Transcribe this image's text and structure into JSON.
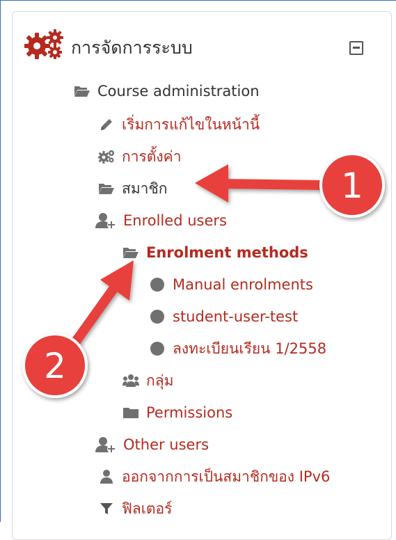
{
  "block": {
    "title": "การจัดการระบบ",
    "collapse_icon": "minus-square-icon"
  },
  "tree": {
    "course_admin": "Course administration",
    "edit_on": "เริ่มการแก้ไขในหน้านี้",
    "settings": "การตั้งค่า",
    "members": "สมาชิก",
    "enrolled_users": "Enrolled users",
    "enrolment_methods": "Enrolment methods",
    "manual_enrolments": "Manual enrolments",
    "student_user_test": "student-user-test",
    "enrol_term": "ลงทะเบียนเรียน 1/2558",
    "groups": "กลุ่ม",
    "permissions": "Permissions",
    "other_users": "Other users",
    "unenrol": "ออกจากการเป็นสมาชิกของ IPv6",
    "filters": "ฟิลเตอร์"
  },
  "annotations": {
    "step1": "1",
    "step2": "2",
    "callout_color": "#e8413c"
  },
  "colors": {
    "link": "#b52a1f",
    "text": "#333333",
    "icon": "#707070",
    "gear": "#b52a1f"
  }
}
